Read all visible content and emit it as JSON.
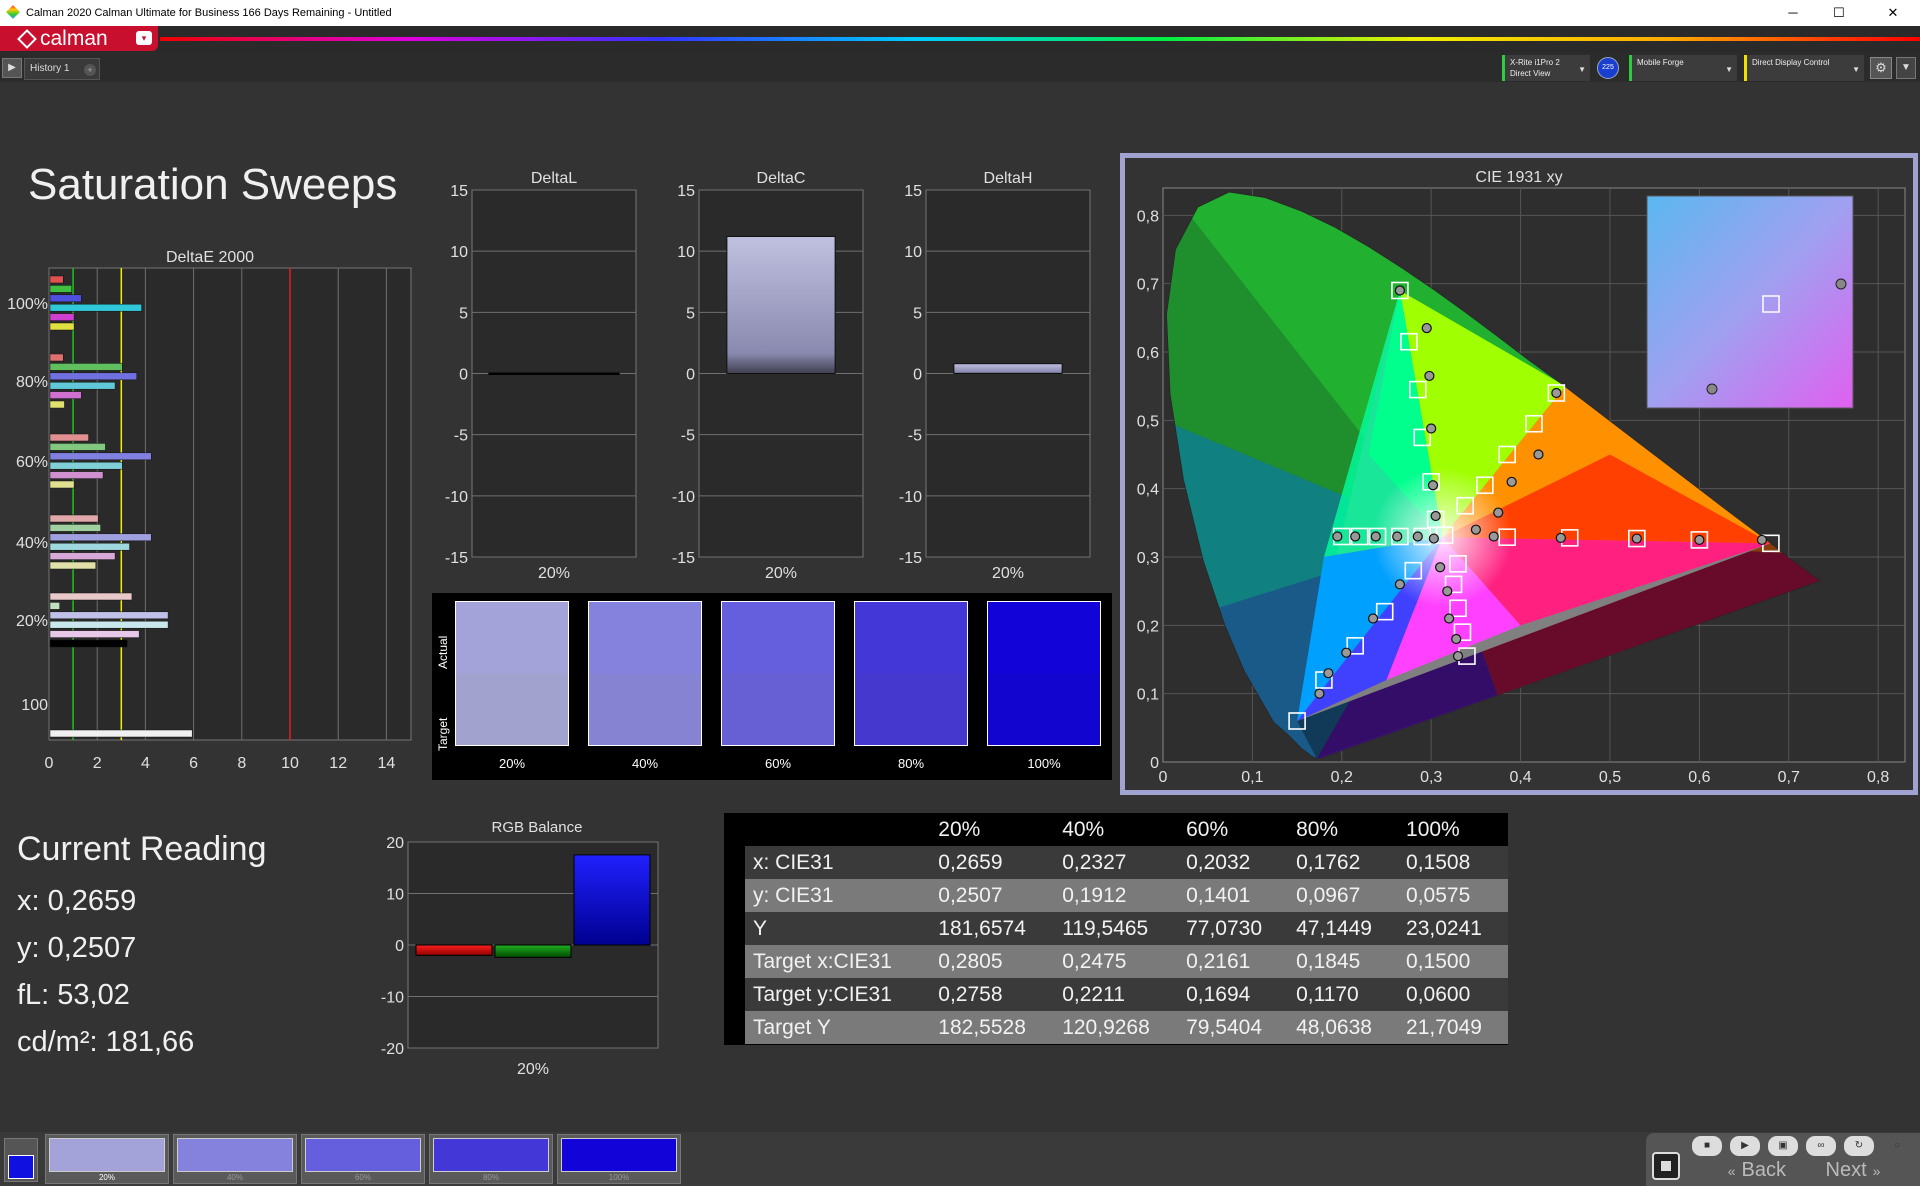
{
  "window": {
    "title": "Calman 2020 Calman Ultimate for Business 166 Days Remaining - Untitled",
    "minimize": "─",
    "maximize": "☐",
    "close": "✕"
  },
  "app": {
    "logo_text": "calman",
    "logo_caret": "▾"
  },
  "tabs": {
    "history": "History 1",
    "add": "+",
    "nav": "▶"
  },
  "devices": [
    {
      "name": "X-Rite i1Pro 2",
      "mode": "Direct View",
      "color": "#2ecc40"
    },
    {
      "badge": "225"
    },
    {
      "name": "Mobile Forge",
      "mode": "",
      "color": "#2ecc40"
    },
    {
      "name": "Direct Display Control",
      "mode": "",
      "color": "#f0e000"
    }
  ],
  "page": {
    "title": "Saturation Sweeps"
  },
  "deltae": {
    "title": "DeltaE 2000",
    "y_labels": [
      "100%",
      "80%",
      "60%",
      "40%",
      "20%",
      "100"
    ],
    "x_ticks": [
      "0",
      "2",
      "4",
      "6",
      "8",
      "10",
      "12",
      "14"
    ],
    "bar_groups": [
      {
        "label": "100%",
        "bars": [
          {
            "v": 0.55,
            "c": "#e05050"
          },
          {
            "v": 0.9,
            "c": "#40c040"
          },
          {
            "v": 1.3,
            "c": "#5050e0"
          },
          {
            "v": 3.8,
            "c": "#30c8d8"
          },
          {
            "v": 1.0,
            "c": "#d040d0"
          },
          {
            "v": 1.0,
            "c": "#e0e040"
          }
        ]
      },
      {
        "label": "80%",
        "bars": [
          {
            "v": 0.55,
            "c": "#e07070"
          },
          {
            "v": 3.0,
            "c": "#60c060"
          },
          {
            "v": 3.6,
            "c": "#7070e0"
          },
          {
            "v": 2.7,
            "c": "#60c8d8"
          },
          {
            "v": 1.3,
            "c": "#d070d0"
          },
          {
            "v": 0.6,
            "c": "#e0e070"
          }
        ]
      },
      {
        "label": "60%",
        "bars": [
          {
            "v": 1.6,
            "c": "#e09090"
          },
          {
            "v": 2.3,
            "c": "#80c880"
          },
          {
            "v": 4.2,
            "c": "#8080e0"
          },
          {
            "v": 3.0,
            "c": "#80d0d8"
          },
          {
            "v": 2.2,
            "c": "#d090d0"
          },
          {
            "v": 1.0,
            "c": "#e0e090"
          }
        ]
      },
      {
        "label": "40%",
        "bars": [
          {
            "v": 2.0,
            "c": "#e0a8a8"
          },
          {
            "v": 2.1,
            "c": "#a0d0a0"
          },
          {
            "v": 4.2,
            "c": "#a0a0e0"
          },
          {
            "v": 3.3,
            "c": "#a0d8e0"
          },
          {
            "v": 2.7,
            "c": "#d8a8d8"
          },
          {
            "v": 1.9,
            "c": "#e0e0a8"
          }
        ]
      },
      {
        "label": "20%",
        "bars": [
          {
            "v": 3.4,
            "c": "#e8c8c8"
          },
          {
            "v": 0.4,
            "c": "#c0e0c0"
          },
          {
            "v": 4.9,
            "c": "#c0c0e8"
          },
          {
            "v": 4.9,
            "c": "#c8e8ec"
          },
          {
            "v": 3.7,
            "c": "#e8c8e8"
          },
          {
            "v": 3.2,
            "c": "#ecec c8"
          }
        ]
      },
      {
        "label": "100",
        "bars": [
          {
            "v": 5.9,
            "c": "#f0f0f0"
          }
        ]
      }
    ],
    "threshold_lines": [
      {
        "v": 1,
        "c": "#20c020"
      },
      {
        "v": 3,
        "c": "#f0f000"
      },
      {
        "v": 10,
        "c": "#e02020"
      }
    ]
  },
  "deltas": [
    {
      "title": "DeltaL",
      "value": 0.0,
      "x_label": "20%",
      "y_ticks": [
        "15",
        "10",
        "5",
        "0",
        "-5",
        "-10",
        "-15"
      ]
    },
    {
      "title": "DeltaC",
      "value": 11.2,
      "x_label": "20%",
      "y_ticks": [
        "15",
        "10",
        "5",
        "0",
        "-5",
        "-10",
        "-15"
      ]
    },
    {
      "title": "DeltaH",
      "value": 0.8,
      "x_label": "20%",
      "y_ticks": [
        "15",
        "10",
        "5",
        "0",
        "-5",
        "-10",
        "-15"
      ]
    }
  ],
  "swatches": {
    "actual_label": "Actual",
    "target_label": "Target",
    "items": [
      {
        "label": "20%",
        "actual": "#a3a3da",
        "target": "#a2a2cf"
      },
      {
        "label": "40%",
        "actual": "#8482dc",
        "target": "#8684d2"
      },
      {
        "label": "60%",
        "actual": "#655fde",
        "target": "#6660d4"
      },
      {
        "label": "80%",
        "actual": "#4437d8",
        "target": "#4538cf"
      },
      {
        "label": "100%",
        "actual": "#1203d8",
        "target": "#1205cf"
      }
    ]
  },
  "cie": {
    "title": "CIE 1931 xy",
    "x_ticks": [
      "0",
      "0,1",
      "0,2",
      "0,3",
      "0,4",
      "0,5",
      "0,6",
      "0,7",
      "0,8"
    ],
    "y_ticks": [
      "0",
      "0,1",
      "0,2",
      "0,3",
      "0,4",
      "0,5",
      "0,6",
      "0,7",
      "0,8"
    ]
  },
  "current_reading": {
    "title": "Current Reading",
    "x": "x: 0,2659",
    "y": "y: 0,2507",
    "fl": "fL: 53,02",
    "cdm2": "cd/m²: 181,66"
  },
  "rgb_balance": {
    "title": "RGB Balance",
    "y_ticks": [
      "20",
      "10",
      "0",
      "-10",
      "-20"
    ],
    "x_label": "20%",
    "values": [
      {
        "c": "red",
        "v": -2.0
      },
      {
        "c": "green",
        "v": -2.4
      },
      {
        "c": "blue",
        "v": 17.5
      }
    ]
  },
  "table": {
    "headers": [
      "",
      "20%",
      "40%",
      "60%",
      "80%",
      "100%"
    ],
    "rows": [
      [
        "x: CIE31",
        "0,2659",
        "0,2327",
        "0,2032",
        "0,1762",
        "0,1508"
      ],
      [
        "y: CIE31",
        "0,2507",
        "0,1912",
        "0,1401",
        "0,0967",
        "0,0575"
      ],
      [
        "Y",
        "181,6574",
        "119,5465",
        "77,0730",
        "47,1449",
        "23,0241"
      ],
      [
        "Target x:CIE31",
        "0,2805",
        "0,2475",
        "0,2161",
        "0,1845",
        "0,1500"
      ],
      [
        "Target y:CIE31",
        "0,2758",
        "0,2211",
        "0,1694",
        "0,1170",
        "0,0600"
      ],
      [
        "Target Y",
        "182,5528",
        "120,9268",
        "79,5404",
        "48,0638",
        "21,7049"
      ]
    ]
  },
  "bottom": {
    "current_color": "#1010e0",
    "patches": [
      {
        "label": "20%",
        "color": "#a3a3da"
      },
      {
        "label": "40%",
        "color": "#8482dc"
      },
      {
        "label": "60%",
        "color": "#655fde"
      },
      {
        "label": "80%",
        "color": "#4437d8"
      },
      {
        "label": "100%",
        "color": "#1203d8"
      }
    ],
    "back_label": "Back",
    "next_label": "Next"
  }
}
